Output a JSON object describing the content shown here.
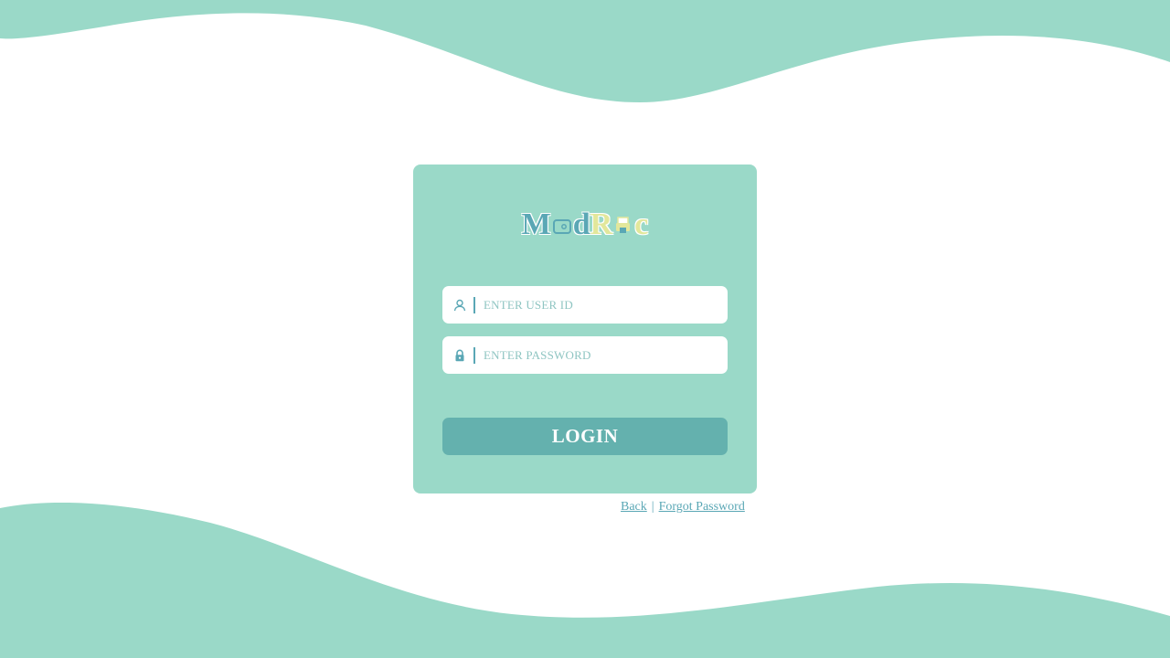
{
  "colors": {
    "wave": "#9ad9c8",
    "card": "#9ad9c8",
    "button": "#64b1ae",
    "accent": "#5aa7b5",
    "logo_yellow": "#e2e79b"
  },
  "logo": {
    "letters": [
      "M",
      "d",
      "R",
      "c"
    ],
    "icons": [
      "wallet-icon",
      "printer-icon"
    ]
  },
  "form": {
    "user_id": {
      "placeholder": "ENTER USER ID",
      "value": "",
      "icon": "user-icon"
    },
    "password": {
      "placeholder": "ENTER PASSWORD",
      "value": "",
      "icon": "lock-icon"
    },
    "login_label": "LOGIN"
  },
  "links": {
    "back": "Back",
    "separator": "|",
    "forgot_password": "Forgot Password"
  }
}
